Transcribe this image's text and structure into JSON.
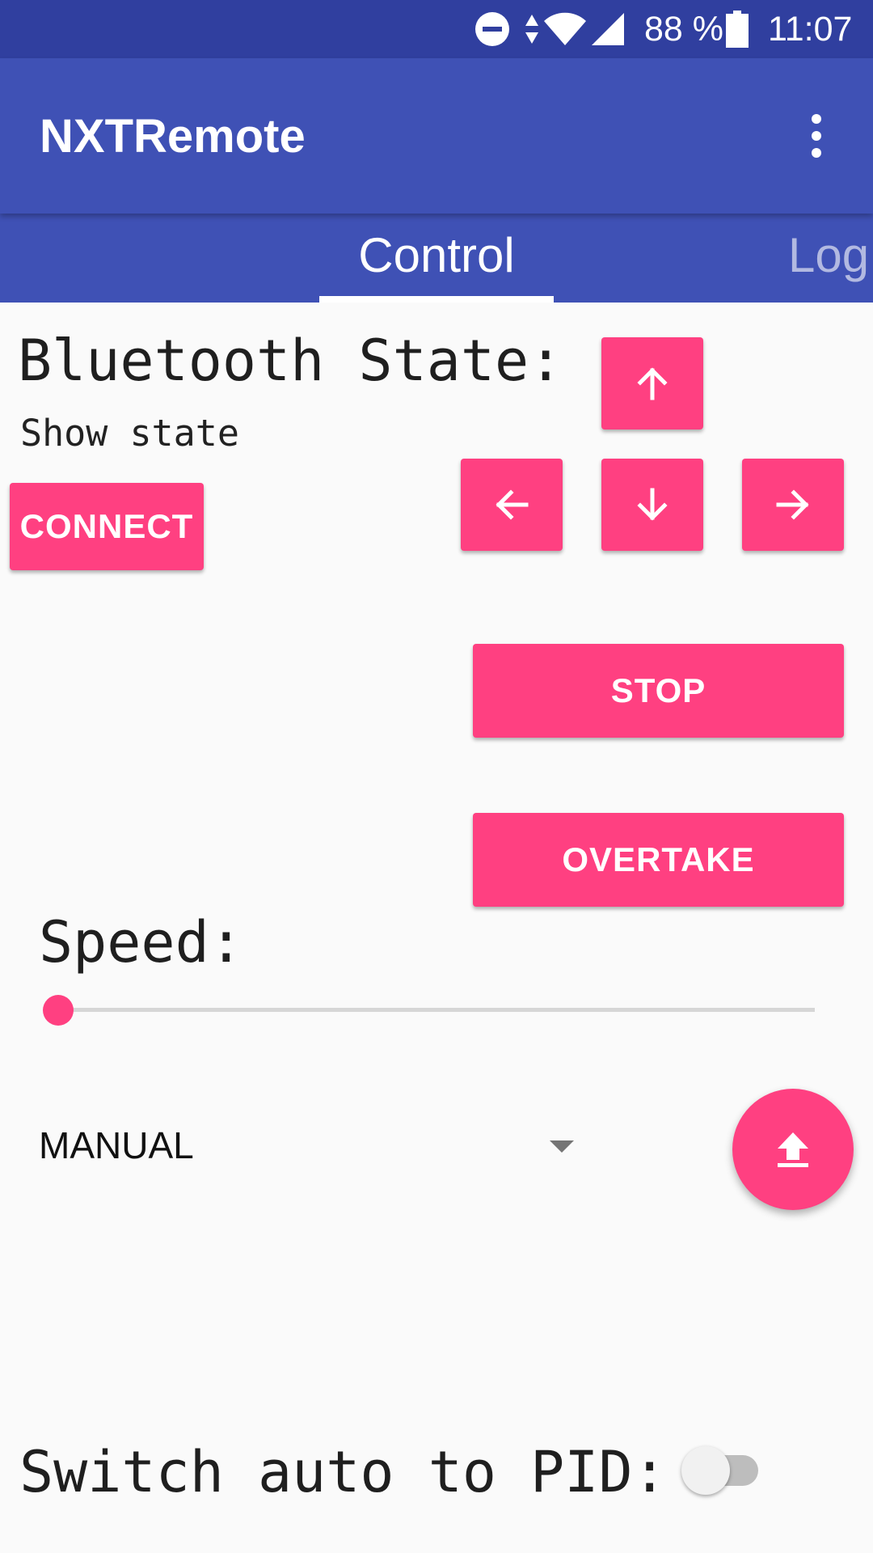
{
  "status_bar": {
    "battery_percent": "88 %",
    "time": "11:07",
    "icons": [
      "do-not-disturb-icon",
      "data-arrows-icon",
      "wifi-icon",
      "cell-signal-icon",
      "battery-icon"
    ]
  },
  "app_bar": {
    "title": "NXTRemote",
    "menu_icon": "overflow-menu-icon"
  },
  "tabs": [
    {
      "label": "Control",
      "selected": true
    },
    {
      "label": "Log",
      "selected": false
    }
  ],
  "bluetooth": {
    "label": "Bluetooth State:",
    "state_text": "Show state",
    "connect_label": "CONNECT"
  },
  "controls": {
    "up_icon": "arrow-up-icon",
    "left_icon": "arrow-left-icon",
    "down_icon": "arrow-down-icon",
    "right_icon": "arrow-right-icon",
    "stop_label": "STOP",
    "overtake_label": "OVERTAKE"
  },
  "speed": {
    "label": "Speed:",
    "value_fraction": 0
  },
  "mode_spinner": {
    "selected": "MANUAL"
  },
  "fab_icon": "upload-icon",
  "pid": {
    "label": "Switch auto to PID:",
    "enabled": false
  },
  "colors": {
    "status_bar": "#303f9f",
    "primary": "#3f51b5",
    "accent": "#ff4081",
    "background": "#fafafa"
  }
}
